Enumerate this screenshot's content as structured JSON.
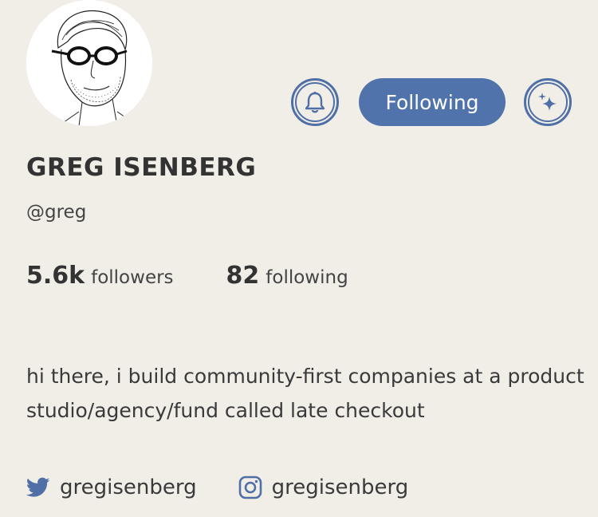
{
  "profile": {
    "name": "GREG ISENBERG",
    "handle": "@greg",
    "bio": "hi there, i build community-first companies at a product studio/agency/fund called late checkout"
  },
  "actions": {
    "follow_label": "Following",
    "bell_icon": "bell-icon",
    "sparkle_icon": "sparkle-icon"
  },
  "stats": {
    "followers_count": "5.6k",
    "followers_label": "followers",
    "following_count": "82",
    "following_label": "following"
  },
  "socials": {
    "twitter": {
      "icon": "twitter-icon",
      "handle": "gregisenberg"
    },
    "instagram": {
      "icon": "instagram-icon",
      "handle": "gregisenberg"
    }
  },
  "colors": {
    "background": "#f1eee7",
    "accent": "#5173ac",
    "text": "#333333"
  }
}
